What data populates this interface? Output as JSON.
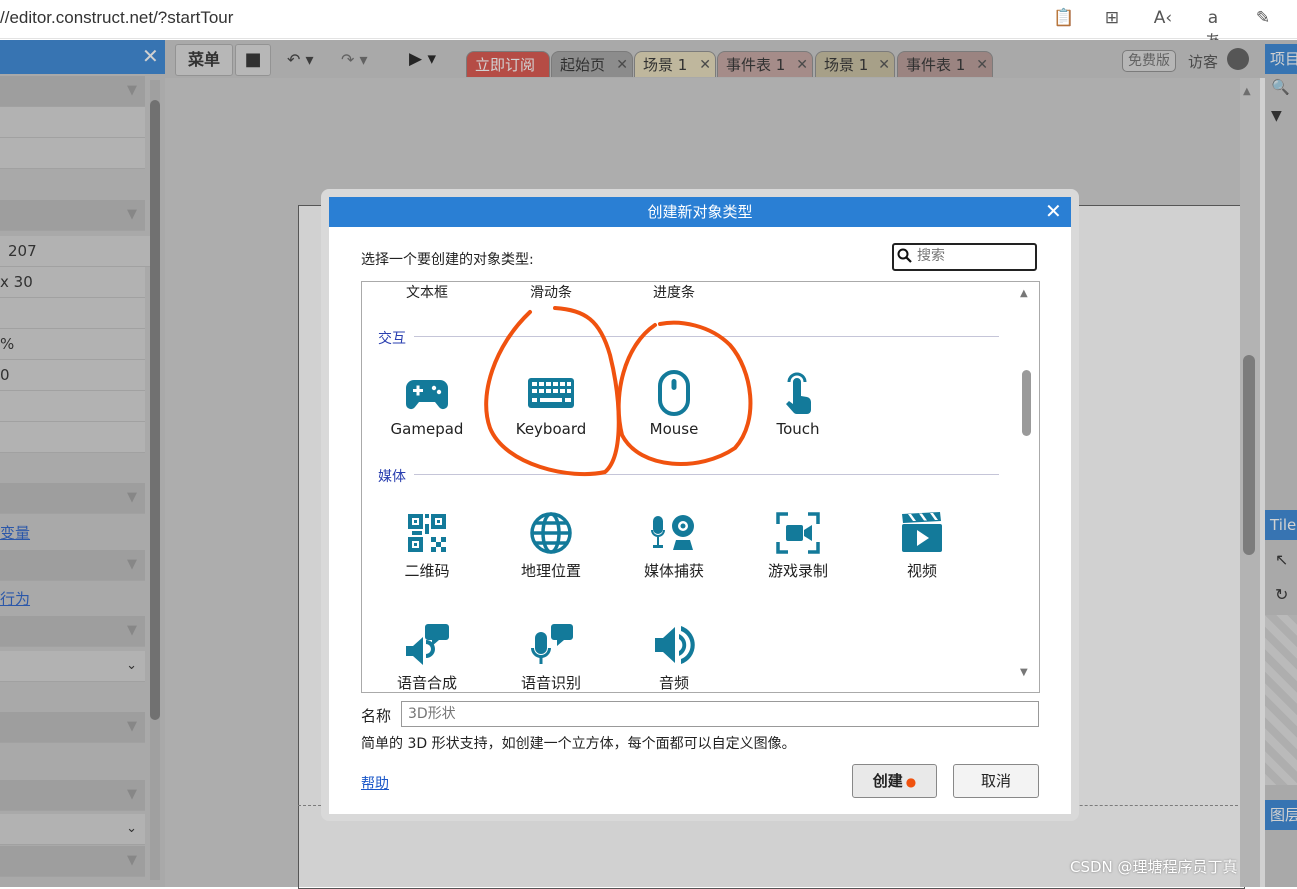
{
  "browser": {
    "url": "//editor.construct.net/?startTour"
  },
  "left_panel": {
    "values": [
      "207",
      "x 30",
      "%",
      "0"
    ],
    "links": [
      "变量",
      "行为"
    ]
  },
  "toolbar": {
    "menu_label": "菜单",
    "tabs": [
      "立即订阅",
      "起始页",
      "场景 1",
      "事件表 1",
      "场景 1",
      "事件表 1"
    ],
    "edition_badge": "免费版",
    "guest_label": "访客"
  },
  "right_panel": {
    "project_title": "项目",
    "tilemap_title": "Tile",
    "layers_title": "图层"
  },
  "dialog": {
    "title": "创建新对象类型",
    "prompt": "选择一个要创建的对象类型:",
    "search_placeholder": "搜索",
    "top_items": [
      "文本框",
      "滑动条",
      "进度条"
    ],
    "categories": [
      {
        "name": "交互",
        "items": [
          {
            "label": "Gamepad",
            "icon": "gamepad-icon"
          },
          {
            "label": "Keyboard",
            "icon": "keyboard-icon"
          },
          {
            "label": "Mouse",
            "icon": "mouse-icon"
          },
          {
            "label": "Touch",
            "icon": "touch-icon"
          }
        ]
      },
      {
        "name": "媒体",
        "items": [
          {
            "label": "二维码",
            "icon": "qr-code-icon"
          },
          {
            "label": "地理位置",
            "icon": "globe-icon"
          },
          {
            "label": "媒体捕获",
            "icon": "webcam-icon"
          },
          {
            "label": "游戏录制",
            "icon": "video-record-icon"
          },
          {
            "label": "视频",
            "icon": "clapperboard-icon"
          },
          {
            "label": "语音合成",
            "icon": "speech-synthesis-icon"
          },
          {
            "label": "语音识别",
            "icon": "speech-recognition-icon"
          },
          {
            "label": "音频",
            "icon": "speaker-icon"
          }
        ]
      }
    ],
    "name_label": "名称",
    "name_placeholder": "3D形状",
    "description": "简单的 3D 形状支持，如创建一个立方体，每个面都可以自定义图像。",
    "help_label": "帮助",
    "create_label": "创建",
    "cancel_label": "取消",
    "accent_color": "#2a7fd4",
    "icon_color": "#137a9a"
  },
  "watermark": "CSDN @理塘程序员丁真",
  "annotation_color": "#f0520f"
}
